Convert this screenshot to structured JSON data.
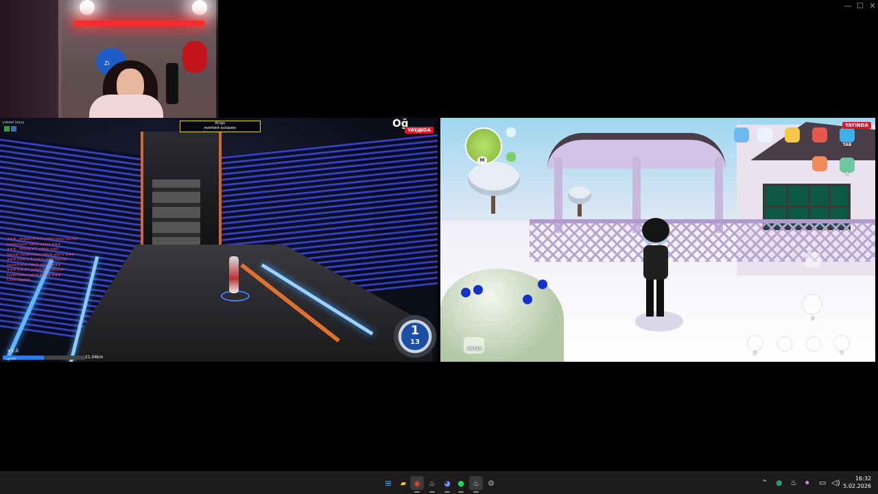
{
  "window": {
    "minimize_glyph": "—",
    "maximize_glyph": "☐",
    "close_glyph": "✕"
  },
  "webcam": {
    "plush_label": "Zi"
  },
  "left_game": {
    "title": "Öğ",
    "live_badge": "YAYINDA",
    "quest": {
      "line1": "Kingu",
      "line2": "everbest autopass"
    },
    "chat_log": [
      "★★★ . pegasun5'e 5 yıldızlı kaya hayvan",
      "kazanmanın tebrik ederiz ★★★",
      "★★★ . Pintoly'e 5 yıldızlı eveli",
      "hayvan kazanmanın tebrik ederiz ★★★",
      "★★★ pixie'ın 5 yıldızlı evcil hayvan",
      "kazanmanın tebrik ederiz ★★★",
      "★★★ Eva'e 5 yıldızlı evcil hayvan",
      "kazanmanın tebrik ederiz ★★★",
      "Cömo başlatıl"
    ],
    "speed_multiplier": "×1.0",
    "player_name": "Lessla",
    "bottom_value": "21.04km",
    "round": {
      "current": "1",
      "total": "13"
    },
    "top_small_text": "yakeel lavuy",
    "channel_label": "yay"
  },
  "right_game": {
    "live_badge": "YAYINDA",
    "minimap_key": "M",
    "hud_keys": {
      "tab": "TAB",
      "b": "B",
      "f": "F",
      "x": "X",
      "t": "T",
      "enter": "ENTER"
    }
  },
  "taskbar": {
    "apps": [
      {
        "name": "windows-start",
        "glyph": "⊞",
        "color": "#4aa3ff"
      },
      {
        "name": "file-explorer",
        "glyph": "▰",
        "color": "#f2c14b"
      },
      {
        "name": "chrome",
        "glyph": "◉",
        "color": "#e8453c"
      },
      {
        "name": "steam",
        "glyph": "♨",
        "color": "#c6d4df"
      },
      {
        "name": "discord",
        "glyph": "◕",
        "color": "#7b8cff"
      },
      {
        "name": "spotify",
        "glyph": "●",
        "color": "#1ed760"
      },
      {
        "name": "steam-active",
        "glyph": "♨",
        "color": "#c6d4df"
      },
      {
        "name": "settings",
        "glyph": "⚙",
        "color": "#bbbbbb"
      }
    ],
    "tray": {
      "chevron": "⌃",
      "time": "16:32",
      "date": "5.02.2026"
    }
  }
}
